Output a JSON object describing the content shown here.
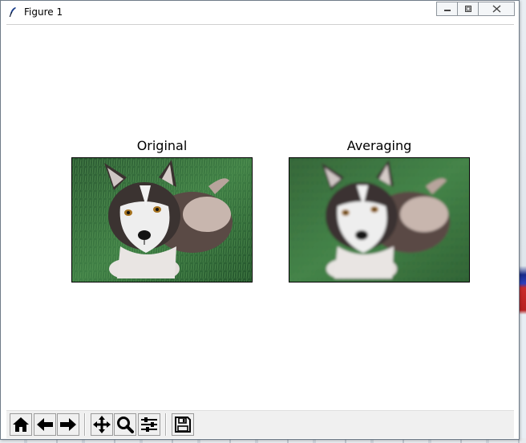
{
  "window": {
    "title": "Figure 1",
    "icon": "feather-icon",
    "controls": [
      "minimize-icon",
      "restore-icon",
      "close-icon"
    ]
  },
  "figure": {
    "subplots": [
      {
        "title": "Original",
        "image": "husky puppy lying on grass, sharp"
      },
      {
        "title": "Averaging",
        "image": "husky puppy lying on grass, blurred"
      }
    ]
  },
  "toolbar": {
    "buttons": [
      {
        "name": "home",
        "icon": "home-icon"
      },
      {
        "name": "back",
        "icon": "arrow-left-icon"
      },
      {
        "name": "forward",
        "icon": "arrow-right-icon"
      },
      {
        "name": "pan",
        "icon": "move-icon"
      },
      {
        "name": "zoom",
        "icon": "magnifier-icon"
      },
      {
        "name": "configure-subplots",
        "icon": "sliders-icon"
      },
      {
        "name": "save",
        "icon": "floppy-disk-icon"
      }
    ]
  },
  "colors": {
    "grass": "#2e6b38",
    "fur_dark": "#3a3230",
    "fur_light": "#eeeeee",
    "toolbar_bg": "#f0f0f0"
  }
}
